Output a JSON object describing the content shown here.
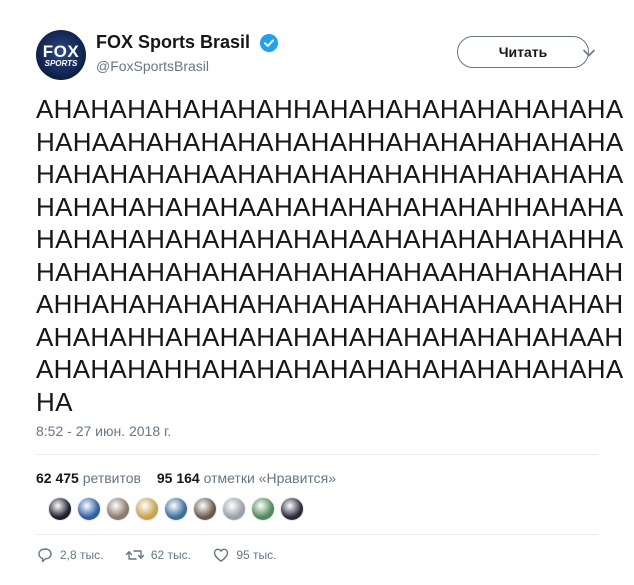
{
  "account": {
    "display_name": "FOX Sports Brasil",
    "handle": "@FoxSportsBrasil",
    "avatar_logo_top": "FOX",
    "avatar_logo_bottom": "SPORTS",
    "verified": true
  },
  "follow_button_label": "Читать",
  "tweet": {
    "lines": [
      "AHAHAHAHAHAHAHHAHAHAHAHAHAHAHAHA",
      "HAHAAHAHAHAHAHAHAHHAHAHAHAHAHAHA",
      "HAHAHAHAHAAHAHAHAHAHAHHAHAHAHAHA",
      "HAHAHAHAHAHAAHAHAHAHAHAHAHHAHAHA",
      "HAHAHAHAHAHAHAHAHAAHAHAHAHAHAHHA",
      "HAHAHAHAHAHAHAHAHAHAHAAHAHAHAHAH",
      "AHHAHAHAHAHAHAHAHAHAHAHAHAAHAHAH",
      "AHAHAHHAHAHAHAHAHAHAHAHAHAHAHAAH",
      "AHAHAHAHHAHAHAHAHAHAHAHAHAHAHAHA",
      "HA"
    ],
    "timestamp": "8:52 - 27 июн. 2018 г."
  },
  "stats": {
    "retweets_count": "62 475",
    "retweets_label": "ретвитов",
    "likes_count": "95 164",
    "likes_label": "отметки «Нравится»"
  },
  "likers": [
    {
      "color": "#1f1f2e"
    },
    {
      "color": "#2f5fa8"
    },
    {
      "color": "#8a7a6a"
    },
    {
      "color": "#c9a24a"
    },
    {
      "color": "#3c6e9e"
    },
    {
      "color": "#6b5a4a"
    },
    {
      "color": "#9aa0a6"
    },
    {
      "color": "#4f8a5a"
    },
    {
      "color": "#2a2a3a"
    }
  ],
  "actions": {
    "reply_count": "2,8 тыс.",
    "retweet_count": "62 тыс.",
    "like_count": "95 тыс."
  },
  "colors": {
    "verified_badge": "#1da1f2",
    "secondary_text": "#657786",
    "primary_text": "#14171a"
  }
}
